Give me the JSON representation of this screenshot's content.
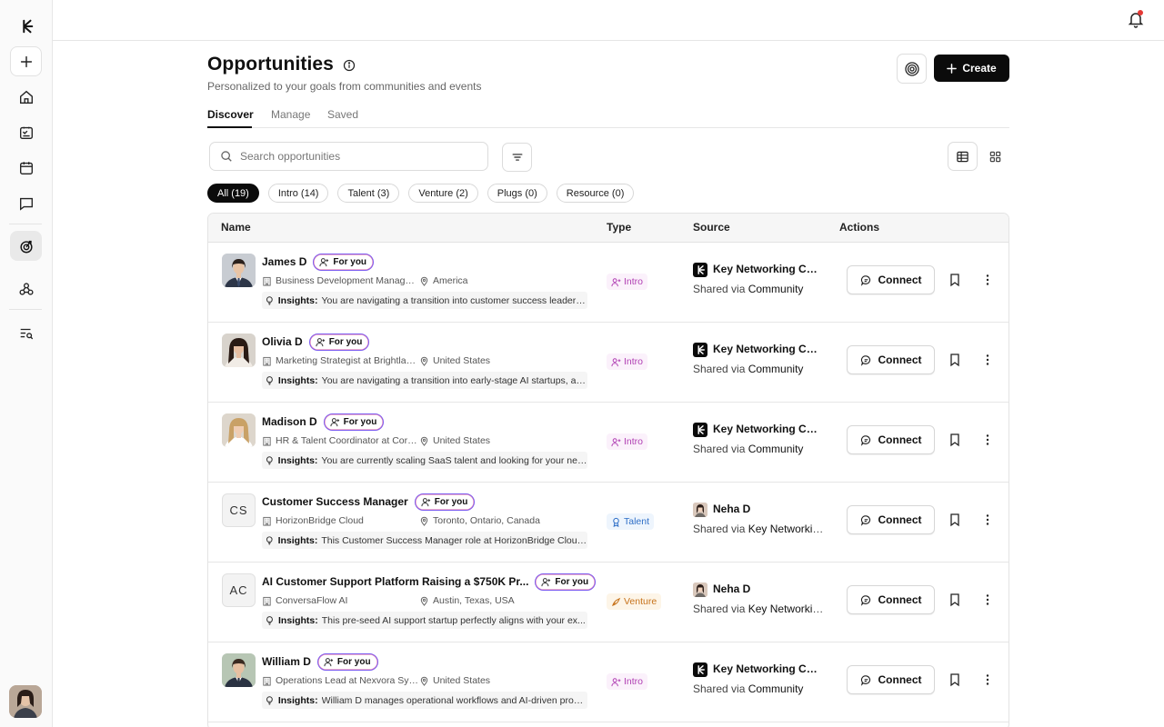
{
  "header": {
    "title": "Opportunities",
    "subtitle": "Personalized to your goals from communities and events",
    "create_label": "Create"
  },
  "tabs": [
    {
      "label": "Discover",
      "active": true
    },
    {
      "label": "Manage",
      "active": false
    },
    {
      "label": "Saved",
      "active": false
    }
  ],
  "search": {
    "placeholder": "Search opportunities"
  },
  "filters": [
    {
      "label": "All (19)",
      "active": true
    },
    {
      "label": "Intro (14)",
      "active": false
    },
    {
      "label": "Talent (3)",
      "active": false
    },
    {
      "label": "Venture (2)",
      "active": false
    },
    {
      "label": "Plugs (0)",
      "active": false
    },
    {
      "label": "Resource (0)",
      "active": false
    }
  ],
  "table": {
    "columns": [
      "Name",
      "Type",
      "Source",
      "Actions"
    ],
    "connect_label": "Connect",
    "for_you_label": "For you",
    "insights_label": "Insights:",
    "rows": [
      {
        "name": "James D",
        "avatar": "photo",
        "org": "Business Development Manager a...",
        "location": "America",
        "insight": "You are navigating a transition into customer success leadersh...",
        "type": "Intro",
        "source_name": "Key Networking Co...",
        "source_via_prefix": "Shared via",
        "source_via": "Community",
        "source_logo": "community"
      },
      {
        "name": "Olivia D",
        "avatar": "photo",
        "org": "Marketing Strategist at Brightlane ...",
        "location": "United States",
        "insight": "You are navigating a transition into early-stage AI startups, an...",
        "type": "Intro",
        "source_name": "Key Networking Co...",
        "source_via_prefix": "Shared via",
        "source_via": "Community",
        "source_logo": "community"
      },
      {
        "name": "Madison D",
        "avatar": "photo",
        "org": "HR & Talent Coordinator at CoreVi...",
        "location": "United States",
        "insight": "You are currently scaling SaaS talent and looking for your next ...",
        "type": "Intro",
        "source_name": "Key Networking Co...",
        "source_via_prefix": "Shared via",
        "source_via": "Community",
        "source_logo": "community"
      },
      {
        "name": "Customer Success Manager",
        "avatar": "CS",
        "org": "HorizonBridge Cloud",
        "location": "Toronto, Ontario, Canada",
        "insight": "This Customer Success Manager role at HorizonBridge Cloud p...",
        "type": "Talent",
        "source_name": "Neha D",
        "source_via_prefix": "Shared via",
        "source_via": "Key Networkin...",
        "source_logo": "person"
      },
      {
        "name": "AI Customer Support Platform Raising a $750K Pr...",
        "avatar": "AC",
        "org": "ConversaFlow AI",
        "location": "Austin, Texas, USA",
        "insight": "This pre-seed AI support startup perfectly aligns with your ex...",
        "type": "Venture",
        "source_name": "Neha D",
        "source_via_prefix": "Shared via",
        "source_via": "Key Networkin...",
        "source_logo": "person"
      },
      {
        "name": "William D",
        "avatar": "photo",
        "org": "Operations Lead at Nexvora Syste...",
        "location": "United States",
        "insight": "William D manages operational workflows and AI-driven proce...",
        "type": "Intro",
        "source_name": "Key Networking Co...",
        "source_via_prefix": "Shared via",
        "source_via": "Community",
        "source_logo": "community"
      }
    ]
  },
  "colors": {
    "accent": "#0b0b0b",
    "intro": "#b03fb3",
    "talent": "#2f6fc7",
    "venture": "#c7731c",
    "notification": "#e53935"
  }
}
